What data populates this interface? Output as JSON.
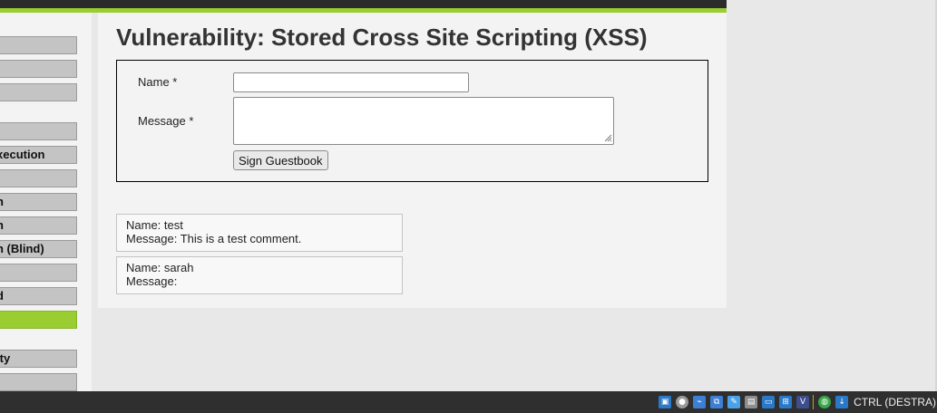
{
  "sidebar": {
    "items": [
      {
        "label": ""
      },
      {
        "label": ""
      },
      {
        "label": ""
      },
      {
        "label": ""
      },
      {
        "label": "xecution"
      },
      {
        "label": ""
      },
      {
        "label": "n"
      },
      {
        "label": "n"
      },
      {
        "label": "n (Blind)"
      },
      {
        "label": ""
      },
      {
        "label": "d"
      },
      {
        "label": "",
        "active": true
      },
      {
        "label": "ity"
      },
      {
        "label": ""
      }
    ]
  },
  "main": {
    "title": "Vulnerability: Stored Cross Site Scripting (XSS)",
    "form": {
      "name_label": "Name *",
      "message_label": "Message *",
      "name_value": "",
      "message_value": "",
      "submit_label": "Sign Guestbook"
    },
    "entries": [
      {
        "name_line": "Name: test",
        "message_line": "Message: This is a test comment."
      },
      {
        "name_line": "Name: sarah",
        "message_line": "Message:"
      }
    ]
  },
  "taskbar": {
    "host_key": "CTRL (DESTRA)",
    "icons": [
      "display-icon",
      "optical-disc-icon",
      "usb-icon",
      "shared-folders-icon",
      "pencil-icon",
      "hard-disk-icon",
      "screen-icon",
      "network-icon",
      "virtualbox-icon",
      "globe-icon",
      "download-arrow-icon"
    ]
  },
  "colors": {
    "accent": "#9acd32",
    "header": "#2b2b2b",
    "page_bg": "#e8e8e8",
    "panel_bg": "#f3f3f3"
  }
}
